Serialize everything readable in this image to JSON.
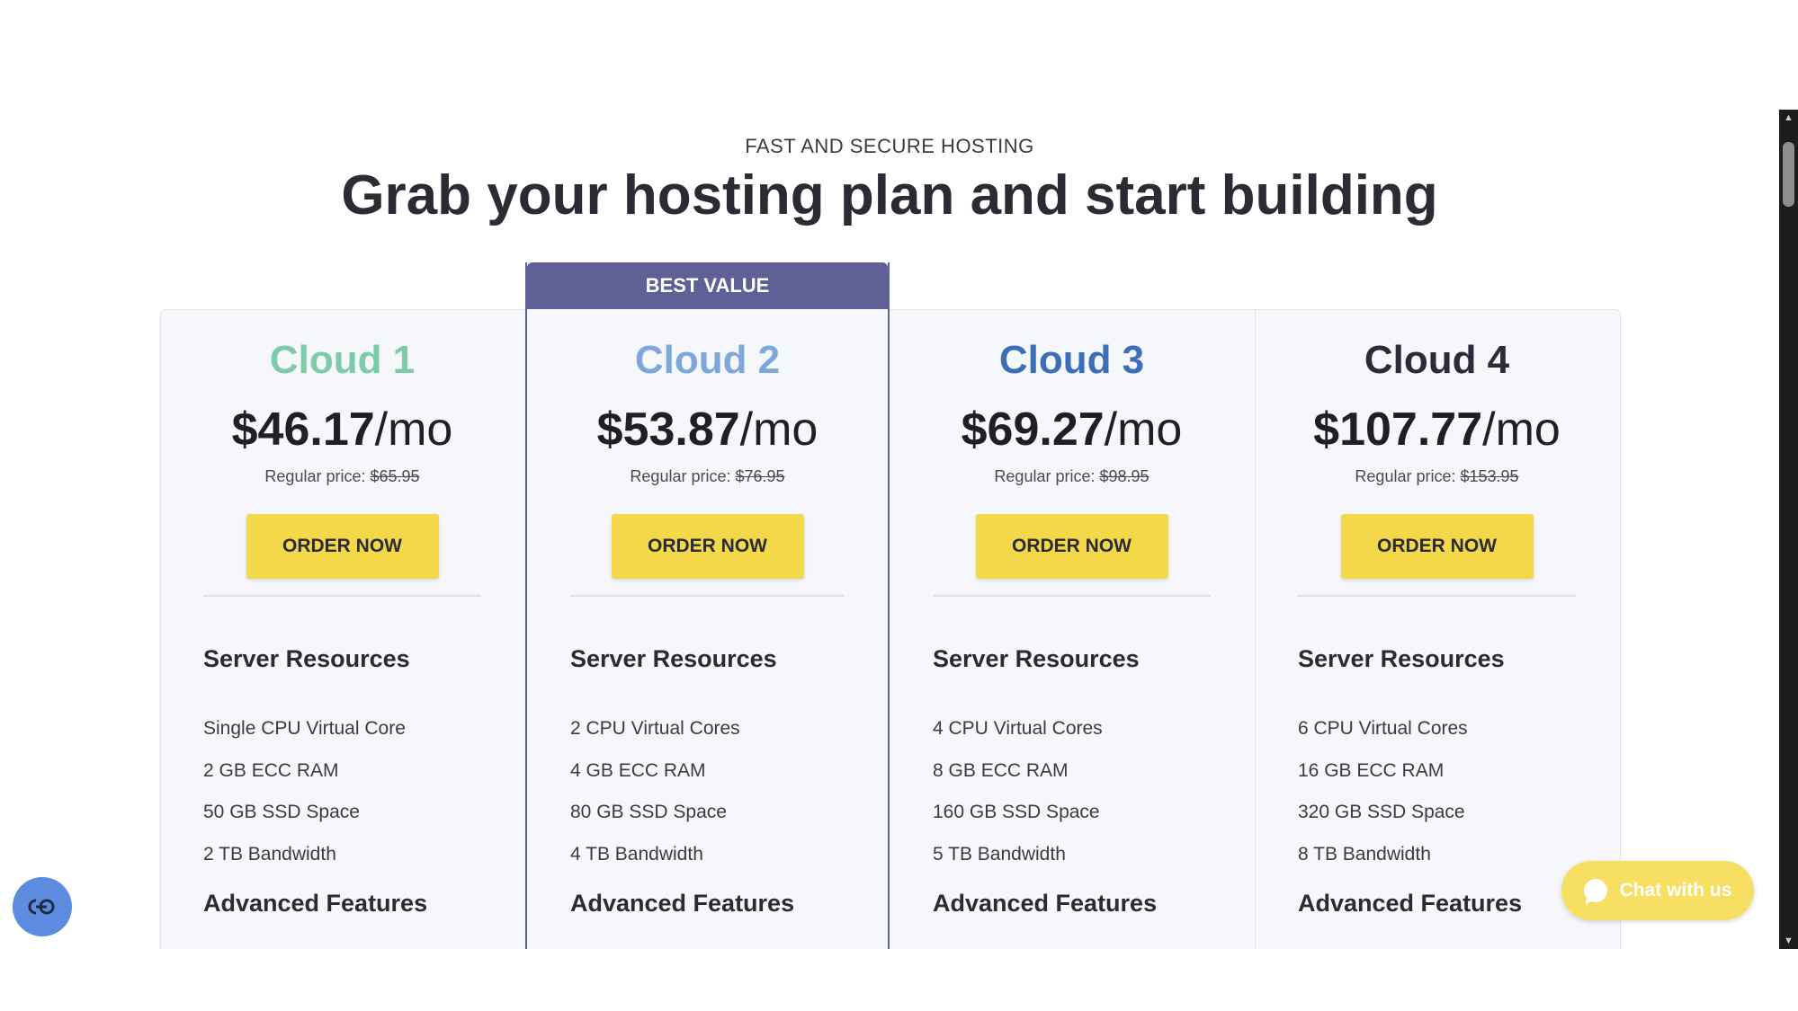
{
  "header": {
    "eyebrow": "FAST AND SECURE HOSTING",
    "title": "Grab your hosting plan and start building"
  },
  "badge": "BEST VALUE",
  "colors": {
    "cloud1": "#7ecbaa",
    "cloud2": "#7ea8dc",
    "cloud3": "#3c6fb8",
    "cloud4": "#2b2b3a",
    "badge_bg": "#5e6096",
    "order_button": "#f3d84a"
  },
  "plans": [
    {
      "name": "Cloud 1",
      "price": "$46.17",
      "per": "/mo",
      "regular_label": "Regular price:",
      "regular_price": "$65.95",
      "order_label": "ORDER NOW",
      "section1": "Server Resources",
      "features": [
        "Single CPU Virtual Core",
        "2 GB ECC RAM",
        "50 GB SSD Space",
        "2 TB Bandwidth"
      ],
      "section2": "Advanced Features"
    },
    {
      "name": "Cloud 2",
      "price": "$53.87",
      "per": "/mo",
      "regular_label": "Regular price:",
      "regular_price": "$76.95",
      "order_label": "ORDER NOW",
      "section1": "Server Resources",
      "features": [
        "2 CPU Virtual Cores",
        "4 GB ECC RAM",
        "80 GB SSD Space",
        "4 TB Bandwidth"
      ],
      "section2": "Advanced Features"
    },
    {
      "name": "Cloud 3",
      "price": "$69.27",
      "per": "/mo",
      "regular_label": "Regular price:",
      "regular_price": "$98.95",
      "order_label": "ORDER NOW",
      "section1": "Server Resources",
      "features": [
        "4 CPU Virtual Cores",
        "8 GB ECC RAM",
        "160 GB SSD Space",
        "5 TB Bandwidth"
      ],
      "section2": "Advanced Features"
    },
    {
      "name": "Cloud 4",
      "price": "$107.77",
      "per": "/mo",
      "regular_label": "Regular price:",
      "regular_price": "$153.95",
      "order_label": "ORDER NOW",
      "section1": "Server Resources",
      "features": [
        "6 CPU Virtual Cores",
        "16 GB ECC RAM",
        "320 GB SSD Space",
        "8 TB Bandwidth"
      ],
      "section2": "Advanced Features"
    }
  ],
  "chat": {
    "label": "Chat with us",
    "icon": "chat-bubble-icon"
  },
  "accessibility": {
    "icon": "accessibility-icon"
  }
}
